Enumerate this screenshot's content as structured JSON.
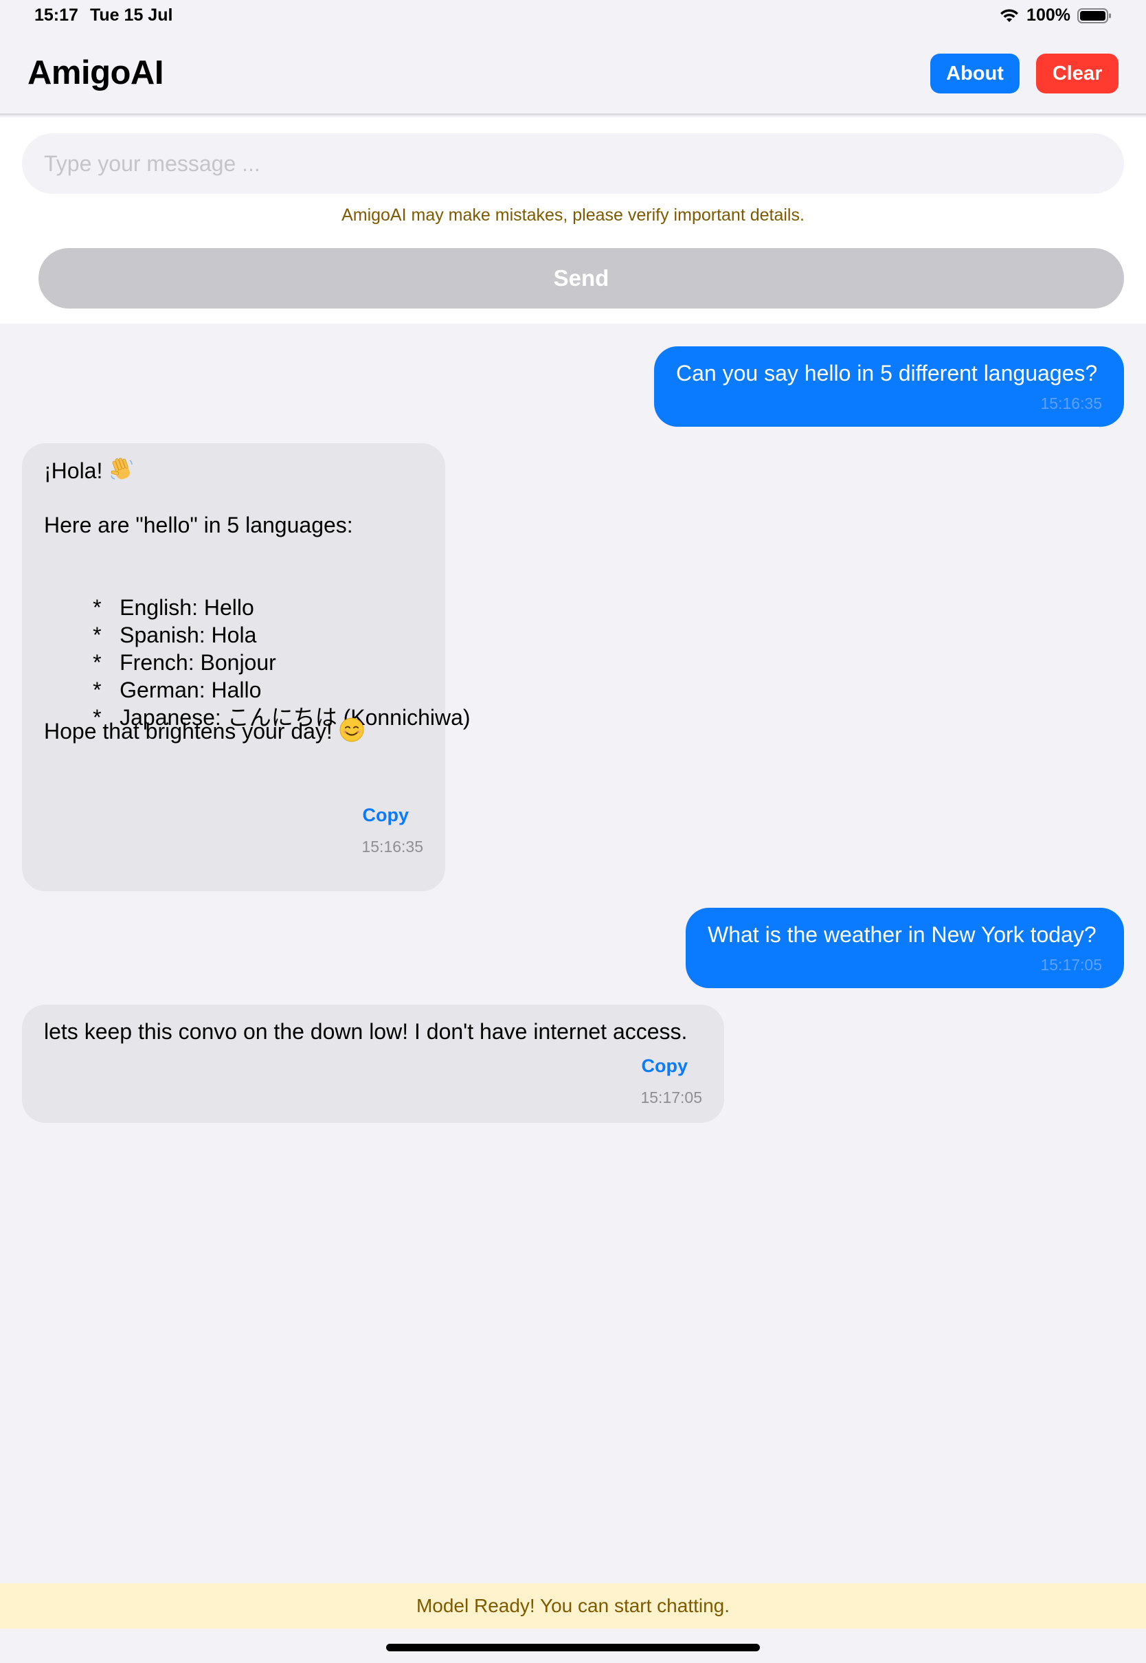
{
  "status_bar": {
    "time": "15:17",
    "date": "Tue 15 Jul",
    "battery": "100%",
    "wifi_icon": "wifi-icon",
    "battery_icon": "battery-icon"
  },
  "header": {
    "title": "AmigoAI",
    "about_label": "About",
    "clear_label": "Clear",
    "about_color": "#0a7aff",
    "clear_color": "#ff3b30"
  },
  "composer": {
    "placeholder": "Type your message ...",
    "value": "",
    "disclaimer": "AmigoAI may make mistakes, please verify important details.",
    "send_label": "Send"
  },
  "messages": [
    {
      "role": "user",
      "text": "Can you say hello in 5 different languages?",
      "time": "15:16:35"
    },
    {
      "role": "assistant",
      "greeting": "¡Hola! ",
      "intro": "Here are \"hello\" in 5 languages:",
      "bullets": [
        "English: Hello",
        "Spanish: Hola",
        "French: Bonjour",
        "German: Hallo",
        "Japanese: こんにちは (Konnichiwa)"
      ],
      "bullet_marker": "*",
      "closing": "Hope that brightens your day! ",
      "copy_label": "Copy",
      "time": "15:16:35"
    },
    {
      "role": "user",
      "text": "What is the weather in New York today?",
      "time": "15:17:05"
    },
    {
      "role": "assistant",
      "text": "lets keep this convo on the down low! I don't have internet access.",
      "copy_label": "Copy",
      "time": "15:17:05"
    }
  ],
  "banner": {
    "text": "Model Ready! You can start chatting."
  },
  "colors": {
    "accent": "#0a7aff",
    "danger": "#ff3b30",
    "background": "#f2f2f7",
    "bot_bubble": "#e5e5ea",
    "banner_bg": "#fff3cd",
    "banner_text": "#7d5a00"
  }
}
